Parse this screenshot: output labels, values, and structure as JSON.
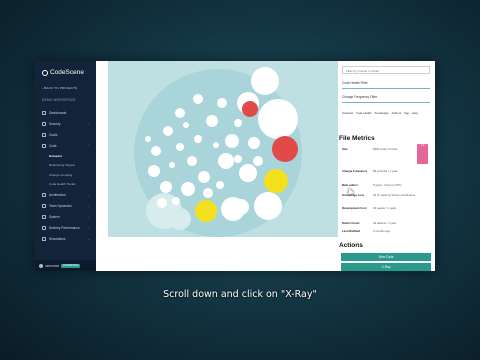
{
  "app": {
    "brand": "CodeScene",
    "back_label": "BACK TO PROJECTS",
    "project_name": "DEMO WORKSPACE"
  },
  "sidebar": {
    "items": [
      {
        "label": "Dashboards",
        "icon": "dashboard-icon",
        "has_chevron": false
      },
      {
        "label": "Security",
        "icon": "shield-icon",
        "has_chevron": true
      },
      {
        "label": "Goals",
        "icon": "target-icon",
        "has_chevron": false
      },
      {
        "label": "Code",
        "icon": "code-icon",
        "has_chevron": true
      }
    ],
    "sub_items": [
      {
        "label": "Hotspots",
        "active": true
      },
      {
        "label": "Refactoring Targets",
        "active": false
      },
      {
        "label": "Change Coupling",
        "active": false
      },
      {
        "label": "Code Health Trends",
        "active": false
      }
    ],
    "items_after": [
      {
        "label": "Architecture",
        "icon": "architecture-icon",
        "has_chevron": true
      },
      {
        "label": "Team Dynamics",
        "icon": "team-icon",
        "has_chevron": true
      },
      {
        "label": "System",
        "icon": "system-icon",
        "has_chevron": true
      },
      {
        "label": "Delivery Performance",
        "icon": "delivery-icon",
        "has_chevron": true
      },
      {
        "label": "Simulations",
        "icon": "simulation-icon",
        "has_chevron": true
      }
    ],
    "user": {
      "name": "username",
      "badge": "ENTERPRISE"
    }
  },
  "panel": {
    "search_placeholder": "Filter by module or folder",
    "code_health_label": "Code Health Filter",
    "change_frequency_label": "Change Frequency Filter",
    "chips": [
      "Hotspots",
      "Code Health",
      "Knowledge",
      "Authors",
      "Age",
      "Help"
    ],
    "file_metrics_title": "File Metrics",
    "metrics": [
      {
        "key": "Size",
        "value": "8400 Lines of Code"
      },
      {
        "key": "Change Frequency",
        "value": "89 commits / 1 year"
      },
      {
        "key": "Main author",
        "value": "Typical - 3 Items (37%)"
      },
      {
        "key": "Knowledge Loss",
        "value": "29 % made by former contributors"
      },
      {
        "key": "Development Cost",
        "value": "29 weeks / 1 years"
      },
      {
        "key": "Defect Count",
        "value": "34 defects / 1 year"
      },
      {
        "key": "Last Modified",
        "value": "2 months ago"
      }
    ],
    "health_badge": "2.3",
    "actions_title": "Actions",
    "actions": [
      "View Code",
      "X-Ray"
    ]
  },
  "caption": "Scroll down and click on \"X-Ray\"",
  "colors": {
    "sidebar_bg": "#12233a",
    "viz_bg": "#bfe0e3",
    "accent": "#2a9a8f",
    "red_hotspot": "#e24a4a",
    "yellow_hotspot": "#f4e01d"
  }
}
